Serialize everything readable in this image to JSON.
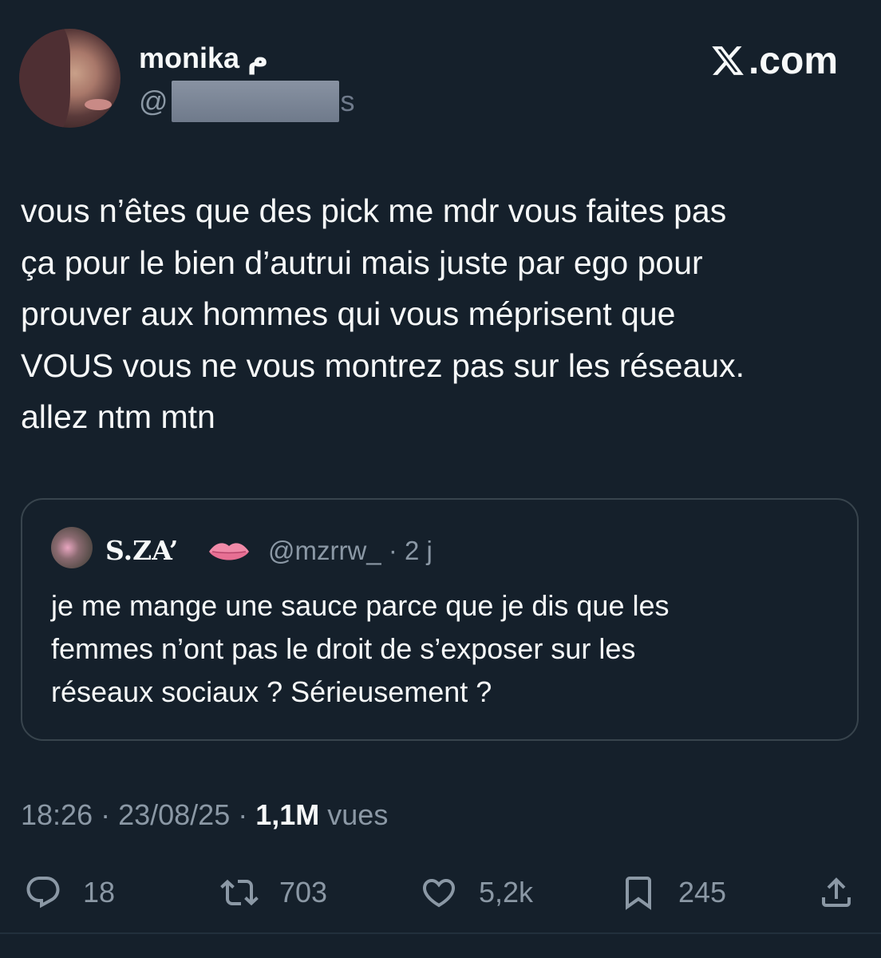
{
  "author": {
    "display_name": "monika م",
    "handle_prefix": "@",
    "handle_tail": "s",
    "avatar_icon": "profile-photo"
  },
  "brand": {
    "logo_icon": "x-logo-icon",
    "label": ".com"
  },
  "tweet": {
    "text": "vous n’êtes que des pick me mdr vous faites pas\nça pour le bien d’autrui mais juste par ego pour\nprouver aux hommes qui vous méprisent que\nVOUS vous ne vous montrez pas sur les réseaux.\nallez ntm mtn"
  },
  "quoted": {
    "name": "S.ZA’",
    "name_emoji_icon": "lips-emoji-icon",
    "handle": "@mzrrw_",
    "separator": "·",
    "age": "2 j",
    "text": "je me mange une sauce parce que je dis que les\nfemmes n’ont pas le droit de s’exposer sur les\nréseaux sociaux ? Sérieusement ?"
  },
  "meta": {
    "time": "18:26",
    "sep1": " · ",
    "date": "23/08/25",
    "sep2": " · ",
    "views_count": "1,1M",
    "views_label": " vues"
  },
  "actions": {
    "reply_count": "18",
    "retweet_count": "703",
    "like_count": "5,2k",
    "bookmark_count": "245"
  },
  "colors": {
    "background": "#15202b",
    "text_primary": "#f7f9f9",
    "text_secondary": "#8b98a5",
    "border": "#38444d"
  }
}
